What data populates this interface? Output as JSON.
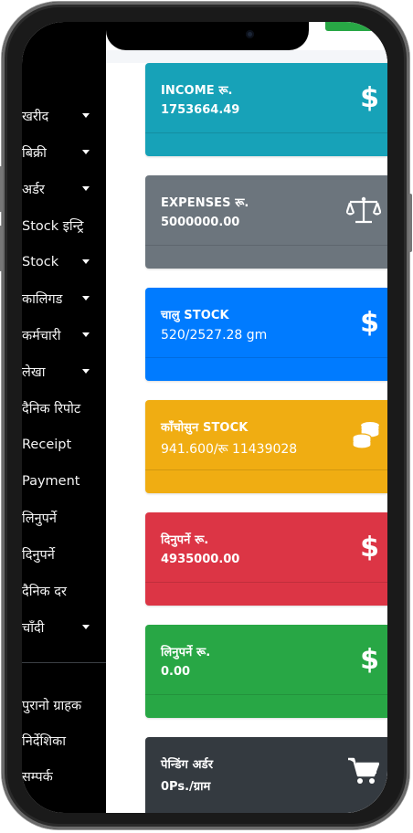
{
  "sidebar": {
    "items": [
      {
        "label": "खरीद",
        "has_caret": true
      },
      {
        "label": "बिक्री",
        "has_caret": true
      },
      {
        "label": "अर्डर",
        "has_caret": true
      },
      {
        "label": "Stock इन्ट्रि",
        "has_caret": false
      },
      {
        "label": "Stock",
        "has_caret": true
      },
      {
        "label": "कालिगड",
        "has_caret": true
      },
      {
        "label": "कर्मचारी",
        "has_caret": true
      },
      {
        "label": "लेखा",
        "has_caret": true
      },
      {
        "label": "दैनिक रिपोट",
        "has_caret": false
      },
      {
        "label": "Receipt",
        "has_caret": false
      },
      {
        "label": "Payment",
        "has_caret": false
      },
      {
        "label": "लिनुपर्ने",
        "has_caret": false
      },
      {
        "label": "दिनुपर्ने",
        "has_caret": false
      },
      {
        "label": "दैनिक दर",
        "has_caret": false
      },
      {
        "label": "चाँदी",
        "has_caret": true
      }
    ],
    "bottom_items": [
      {
        "label": "पुरानो ग्राहक"
      },
      {
        "label": "निर्देशिका"
      },
      {
        "label": "सम्पर्क"
      }
    ]
  },
  "cards": [
    {
      "title": "INCOME रू.",
      "value": "1753664.49",
      "icon": "dollar-icon",
      "color": "#17a2b8"
    },
    {
      "title": "EXPENSES रू.",
      "value": "5000000.00",
      "icon": "balance-scale-icon",
      "color": "#6c757d"
    },
    {
      "title": "चालु STOCK",
      "value": "520/2527.28 gm",
      "icon": "dollar-icon",
      "color": "#007bff"
    },
    {
      "title": "काँचोसुन STOCK",
      "value": "941.600/रू 11439028",
      "icon": "coins-icon",
      "color": "#f0ad12"
    },
    {
      "title": "दिनुपर्ने रू.",
      "value": "4935000.00",
      "icon": "dollar-icon",
      "color": "#dc3545"
    },
    {
      "title": "लिनुपर्ने रू.",
      "value": "0.00",
      "icon": "dollar-icon",
      "color": "#28a745"
    },
    {
      "title": "पेन्डिंग अर्डर",
      "value": "0Ps./ग्राम",
      "icon": "shopping-cart-icon",
      "color": "#343a40"
    }
  ],
  "icons": {
    "dollar": "$"
  }
}
